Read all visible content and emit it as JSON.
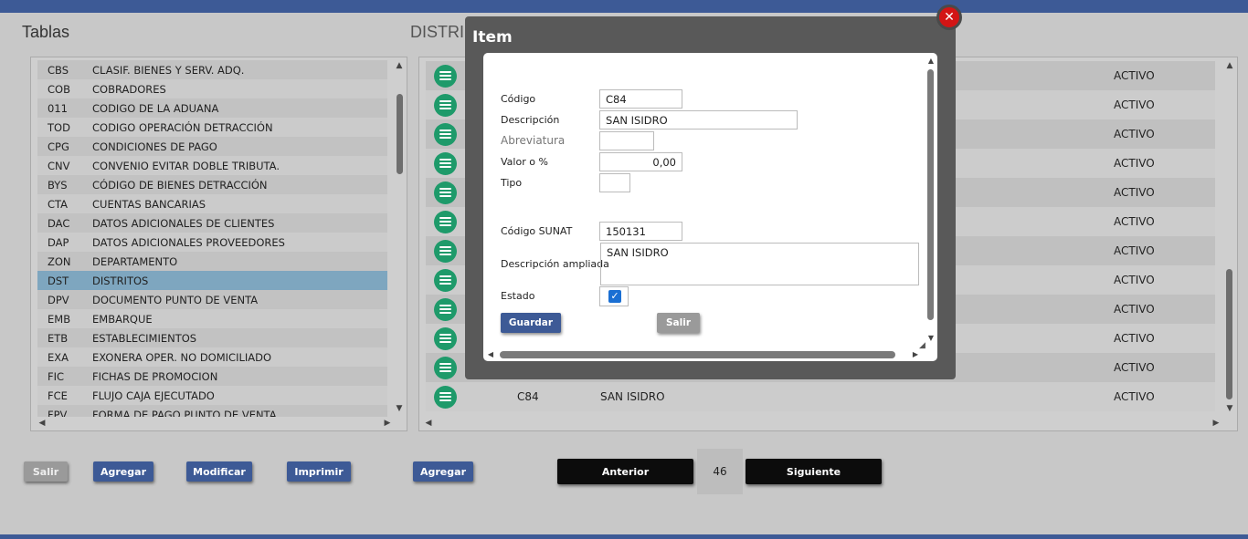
{
  "left_title": "Tablas",
  "right_title": "DISTRI",
  "tablas": [
    {
      "code": "CBS",
      "desc": "CLASIF. BIENES Y SERV. ADQ."
    },
    {
      "code": "COB",
      "desc": "COBRADORES"
    },
    {
      "code": "011",
      "desc": "CODIGO DE LA ADUANA"
    },
    {
      "code": "TOD",
      "desc": "CODIGO OPERACIÓN DETRACCIÓN"
    },
    {
      "code": "CPG",
      "desc": "CONDICIONES DE PAGO"
    },
    {
      "code": "CNV",
      "desc": "CONVENIO EVITAR DOBLE TRIBUTA."
    },
    {
      "code": "BYS",
      "desc": "CÓDIGO DE BIENES DETRACCIÓN"
    },
    {
      "code": "CTA",
      "desc": "CUENTAS BANCARIAS"
    },
    {
      "code": "DAC",
      "desc": "DATOS ADICIONALES DE CLIENTES"
    },
    {
      "code": "DAP",
      "desc": "DATOS ADICIONALES PROVEEDORES"
    },
    {
      "code": "ZON",
      "desc": "DEPARTAMENTO"
    },
    {
      "code": "DST",
      "desc": "DISTRITOS"
    },
    {
      "code": "DPV",
      "desc": "DOCUMENTO PUNTO DE VENTA"
    },
    {
      "code": "EMB",
      "desc": "EMBARQUE"
    },
    {
      "code": "ETB",
      "desc": "ESTABLECIMIENTOS"
    },
    {
      "code": "EXA",
      "desc": "EXONERA OPER. NO DOMICILIADO"
    },
    {
      "code": "FIC",
      "desc": "FICHAS DE PROMOCION"
    },
    {
      "code": "FCE",
      "desc": "FLUJO CAJA EJECUTADO"
    },
    {
      "code": "FPV",
      "desc": "FORMA DE PAGO PUNTO DE VENTA"
    }
  ],
  "distritos": [
    {
      "code": "",
      "desc": "",
      "state": "ACTIVO"
    },
    {
      "code": "",
      "desc": "",
      "state": "ACTIVO"
    },
    {
      "code": "",
      "desc": "",
      "state": "ACTIVO"
    },
    {
      "code": "",
      "desc": "",
      "state": "ACTIVO"
    },
    {
      "code": "",
      "desc": "",
      "state": "ACTIVO"
    },
    {
      "code": "",
      "desc": "",
      "state": "ACTIVO"
    },
    {
      "code": "",
      "desc": "",
      "state": "ACTIVO"
    },
    {
      "code": "",
      "desc": "",
      "state": "ACTIVO"
    },
    {
      "code": "",
      "desc": "",
      "state": "ACTIVO"
    },
    {
      "code": "",
      "desc": "",
      "state": "ACTIVO"
    },
    {
      "code": "",
      "desc": "",
      "state": "ACTIVO"
    },
    {
      "code": "C84",
      "desc": "SAN ISIDRO",
      "state": "ACTIVO"
    }
  ],
  "buttons": {
    "salir": "Salir",
    "agregar_left": "Agregar",
    "modificar": "Modificar",
    "imprimir": "Imprimir",
    "agregar_right": "Agregar",
    "anterior": "Anterior",
    "page": "46",
    "siguiente": "Siguiente"
  },
  "modal": {
    "title": "Item",
    "labels": {
      "codigo": "Código",
      "descripcion": "Descripción",
      "abreviatura": "Abreviatura",
      "valor": "Valor o %",
      "tipo": "Tipo",
      "codigo_sunat": "Código SUNAT",
      "descripcion_ampliada": "Descripción ampliada",
      "estado": "Estado"
    },
    "values": {
      "codigo": "C84",
      "descripcion": "SAN ISIDRO",
      "abreviatura": "",
      "valor": "0,00",
      "tipo": "",
      "codigo_sunat": "150131",
      "descripcion_ampliada": "SAN ISIDRO",
      "estado": true
    },
    "guardar": "Guardar",
    "salir": "Salir"
  },
  "colors": {
    "brand": "#3d5a96",
    "selected_row": "#7ea6bf",
    "row_button": "#1e9a6a",
    "close": "#d31515"
  }
}
